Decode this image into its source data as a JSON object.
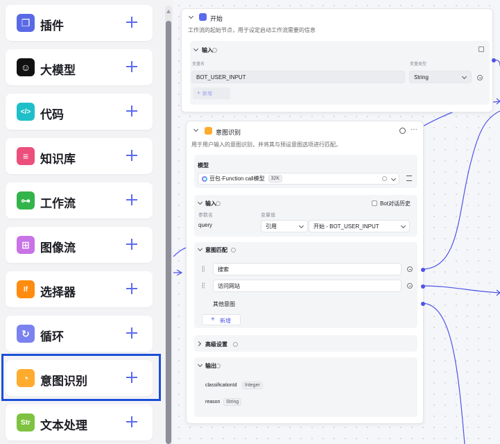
{
  "sidebar": {
    "items": [
      {
        "label": "插件",
        "icon": "plugin-icon",
        "color": "#5a69e6"
      },
      {
        "label": "大模型",
        "icon": "llm-icon",
        "color": "#111111"
      },
      {
        "label": "代码",
        "icon": "code-icon",
        "color": "#1fbfc9"
      },
      {
        "label": "知识库",
        "icon": "knowledge-icon",
        "color": "#ec4f7b"
      },
      {
        "label": "工作流",
        "icon": "workflow-icon",
        "color": "#33b44a"
      },
      {
        "label": "图像流",
        "icon": "imageflow-icon",
        "color": "#c873e6"
      },
      {
        "label": "选择器",
        "icon": "selector-icon",
        "color": "#ff8c10"
      },
      {
        "label": "循环",
        "icon": "loop-icon",
        "color": "#7a82f0"
      },
      {
        "label": "意图识别",
        "icon": "intent-icon",
        "color": "#ffab2e"
      },
      {
        "label": "文本处理",
        "icon": "text-process-icon",
        "color": "#7ec241"
      }
    ],
    "selected_index": 8
  },
  "start_node": {
    "title": "开始",
    "description": "工作流的起始节点，用于设定启动工作流需要的信息",
    "input_title": "输入",
    "col_name": "变量名",
    "col_type": "变量类型",
    "var_name": "BOT_USER_INPUT",
    "var_type": "String",
    "add_label": "新增"
  },
  "intent_node": {
    "title": "意图识别",
    "description": "用于用户输入的意图识别，并将其与预设意图选项进行匹配。",
    "model_title": "模型",
    "model_name": "豆包·Function call模型",
    "model_ctx": "32K",
    "input_title": "输入",
    "bot_history_label": "Bot对话历史",
    "col_param": "参数名",
    "col_value": "变量值",
    "param_name": "query",
    "ref_type": "引用",
    "ref_value": "开始 - BOT_USER_INPUT",
    "intent_title": "意图匹配",
    "intents": [
      "搜索",
      "访问网站"
    ],
    "other_intent": "其他意图",
    "add_label": "新增",
    "advanced_title": "高级设置",
    "output_title": "输出",
    "outputs": [
      {
        "name": "classificationId",
        "type": "Integer"
      },
      {
        "name": "reason",
        "type": "String"
      }
    ]
  },
  "colors": {
    "accent": "#4d53e8",
    "selection": "#1a4fd6"
  }
}
